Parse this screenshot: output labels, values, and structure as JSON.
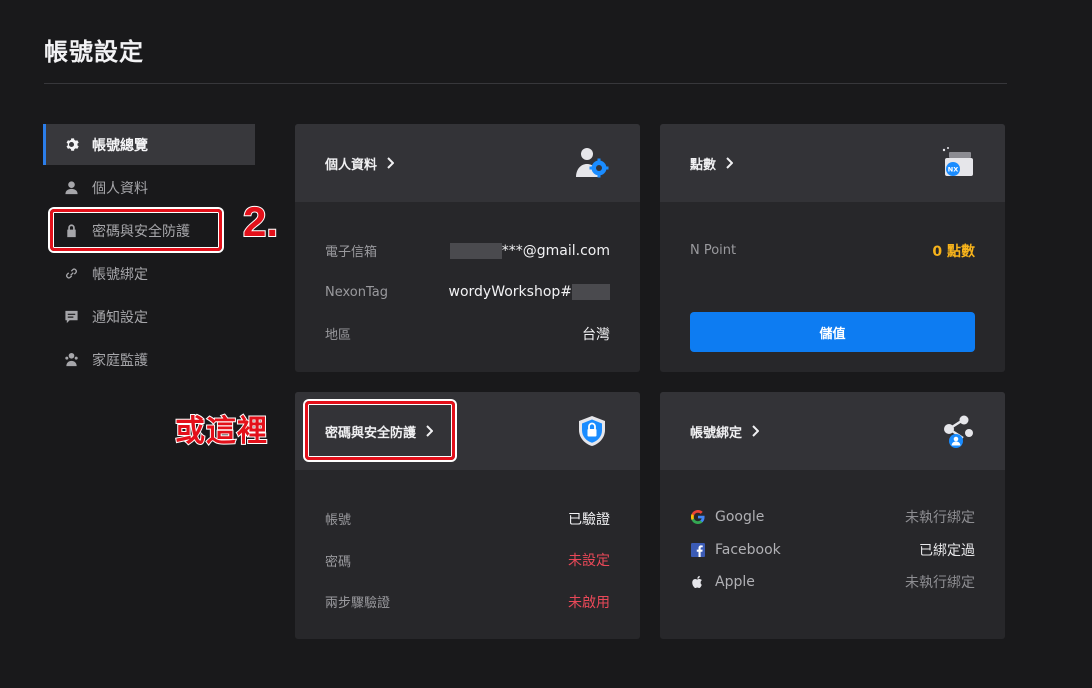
{
  "page": {
    "title": "帳號設定"
  },
  "sidebar": {
    "items": [
      {
        "label": "帳號總覽",
        "icon": "gear-icon",
        "active": true
      },
      {
        "label": "個人資料",
        "icon": "user-icon"
      },
      {
        "label": "密碼與安全防護",
        "icon": "lock-icon"
      },
      {
        "label": "帳號綁定",
        "icon": "link-icon"
      },
      {
        "label": "通知設定",
        "icon": "message-icon"
      },
      {
        "label": "家庭監護",
        "icon": "family-icon"
      }
    ]
  },
  "annotations": {
    "step": "2.",
    "here": "或這裡",
    "color": "#e3101a"
  },
  "cards": {
    "profile": {
      "title": "個人資料",
      "icon": "person-gear-icon",
      "rows": [
        {
          "label": "電子信箱",
          "value": "***@gmail.com"
        },
        {
          "label": "NexonTag",
          "value": "wordyWorkshop#"
        },
        {
          "label": "地區",
          "value": "台灣"
        }
      ]
    },
    "points": {
      "title": "點數",
      "icon": "nx-wallet-icon",
      "label": "N Point",
      "value": "0 點數",
      "button": "儲值"
    },
    "security": {
      "title": "密碼與安全防護",
      "icon": "shield-lock-icon",
      "rows": [
        {
          "label": "帳號",
          "value": "已驗證"
        },
        {
          "label": "密碼",
          "value": "未設定"
        },
        {
          "label": "兩步驟驗證",
          "value": "未啟用"
        }
      ]
    },
    "binding": {
      "title": "帳號綁定",
      "icon": "share-network-icon",
      "rows": [
        {
          "brand": "Google",
          "status": "未執行綁定"
        },
        {
          "brand": "Facebook",
          "status": "已綁定過"
        },
        {
          "brand": "Apple",
          "status": "未執行綁定"
        }
      ]
    }
  },
  "colors": {
    "accent": "#0d7cf2",
    "alert": "#e94858",
    "gold": "#f7b31b",
    "bg": "#19191b"
  }
}
